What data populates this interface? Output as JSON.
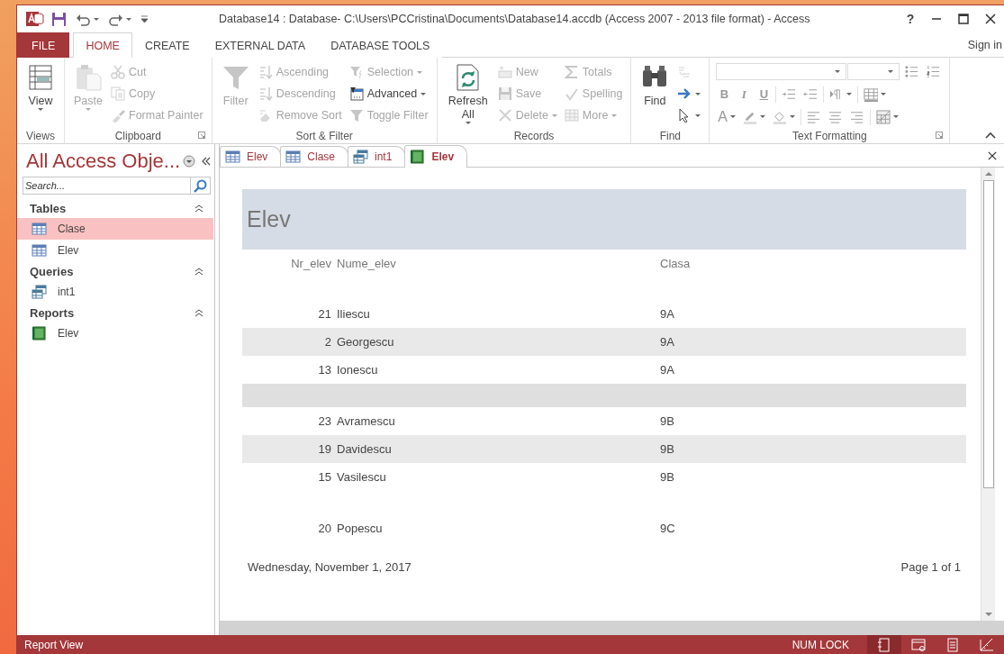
{
  "window": {
    "title": "Database14 : Database- C:\\Users\\PCCristina\\Documents\\Database14.accdb (Access 2007 - 2013 file format) - Access",
    "help": "?"
  },
  "ribbon_tabs": [
    {
      "label": "FILE",
      "kind": "file",
      "selected": false
    },
    {
      "label": "HOME",
      "kind": "tab",
      "selected": true
    },
    {
      "label": "CREATE",
      "kind": "tab",
      "selected": false
    },
    {
      "label": "EXTERNAL DATA",
      "kind": "tab",
      "selected": false
    },
    {
      "label": "DATABASE TOOLS",
      "kind": "tab",
      "selected": false
    }
  ],
  "sign_in": "Sign in",
  "ribbon": {
    "groups": [
      {
        "label": "Views",
        "kind": "commands",
        "launcher": false,
        "commands": [
          {
            "label": "View",
            "kind": "large",
            "disabled": false,
            "dropdown": true
          }
        ]
      },
      {
        "label": "Clipboard",
        "kind": "commands",
        "launcher": true,
        "commands": [
          {
            "label": "Paste",
            "kind": "large",
            "disabled": true,
            "dropdown": true
          },
          {
            "label": "Cut",
            "kind": "small",
            "disabled": true,
            "dropdown": false
          },
          {
            "label": "Copy",
            "kind": "small",
            "disabled": true,
            "dropdown": false
          },
          {
            "label": "Format Painter",
            "kind": "small",
            "disabled": true,
            "dropdown": false
          }
        ]
      },
      {
        "label": "Sort & Filter",
        "kind": "commands",
        "launcher": false,
        "commands": [
          {
            "label": "Filter",
            "kind": "large",
            "disabled": true,
            "dropdown": false
          },
          {
            "label": "Ascending",
            "kind": "small",
            "disabled": true,
            "dropdown": false
          },
          {
            "label": "Descending",
            "kind": "small",
            "disabled": true,
            "dropdown": false
          },
          {
            "label": "Remove Sort",
            "kind": "small",
            "disabled": true,
            "dropdown": false
          },
          {
            "label": "Selection",
            "kind": "small",
            "disabled": true,
            "dropdown": true
          },
          {
            "label": "Advanced",
            "kind": "small",
            "disabled": false,
            "dropdown": true
          },
          {
            "label": "Toggle Filter",
            "kind": "small",
            "disabled": true,
            "dropdown": false
          }
        ]
      },
      {
        "label": "Records",
        "kind": "commands",
        "launcher": false,
        "commands": [
          {
            "label": "Refresh All",
            "kind": "large",
            "disabled": false,
            "dropdown": true
          },
          {
            "label": "New",
            "kind": "small",
            "disabled": true,
            "dropdown": false
          },
          {
            "label": "Save",
            "kind": "small",
            "disabled": true,
            "dropdown": false
          },
          {
            "label": "Delete",
            "kind": "small",
            "disabled": true,
            "dropdown": true
          },
          {
            "label": "Totals",
            "kind": "small",
            "disabled": true,
            "dropdown": false
          },
          {
            "label": "Spelling",
            "kind": "small",
            "disabled": true,
            "dropdown": false
          },
          {
            "label": "More",
            "kind": "small",
            "disabled": true,
            "dropdown": true
          }
        ]
      },
      {
        "label": "Find",
        "kind": "commands",
        "launcher": false,
        "commands": [
          {
            "label": "Find",
            "kind": "large",
            "disabled": false,
            "dropdown": false
          },
          {
            "kind": "small",
            "disabled": true,
            "dropdown": false
          },
          {
            "kind": "small",
            "disabled": false,
            "dropdown": true
          },
          {
            "kind": "small",
            "disabled": false,
            "dropdown": true
          }
        ]
      },
      {
        "label": "Text Formatting",
        "kind": "formatting",
        "launcher": true,
        "glyphs": [
          "B",
          "I",
          "U",
          "A"
        ]
      }
    ]
  },
  "navigation": {
    "title": "All Access Obje...",
    "search_placeholder": "Search...",
    "groups": [
      {
        "label": "Tables",
        "items": [
          {
            "label": "Clase",
            "kind": "table",
            "selected": true
          },
          {
            "label": "Elev",
            "kind": "table",
            "selected": false
          }
        ]
      },
      {
        "label": "Queries",
        "items": [
          {
            "label": "int1",
            "kind": "query",
            "selected": false
          }
        ]
      },
      {
        "label": "Reports",
        "items": [
          {
            "label": "Elev",
            "kind": "report",
            "selected": false
          }
        ]
      }
    ]
  },
  "document_tabs": [
    {
      "label": "Elev",
      "kind": "table",
      "selected": false
    },
    {
      "label": "Clase",
      "kind": "table",
      "selected": false
    },
    {
      "label": "int1",
      "kind": "query",
      "selected": false
    },
    {
      "label": "Elev",
      "kind": "report",
      "selected": true
    }
  ],
  "report": {
    "title": "Elev",
    "columns": [
      "Nr_elev",
      "Nume_elev",
      "Clasa"
    ],
    "rows": [
      {
        "kind": "group",
        "shaded": false
      },
      {
        "kind": "record",
        "shaded": false,
        "cells": [
          "21",
          "Iliescu",
          "9A"
        ]
      },
      {
        "kind": "record",
        "shaded": true,
        "cells": [
          "2",
          "Georgescu",
          "9A"
        ]
      },
      {
        "kind": "record",
        "shaded": false,
        "cells": [
          "13",
          "Ionescu",
          "9A"
        ]
      },
      {
        "kind": "group",
        "shaded": true
      },
      {
        "kind": "record",
        "shaded": false,
        "cells": [
          "23",
          "Avramescu",
          "9B"
        ]
      },
      {
        "kind": "record",
        "shaded": true,
        "cells": [
          "19",
          "Davidescu",
          "9B"
        ]
      },
      {
        "kind": "record",
        "shaded": false,
        "cells": [
          "15",
          "Vasilescu",
          "9B"
        ]
      },
      {
        "kind": "group",
        "shaded": false
      },
      {
        "kind": "record",
        "shaded": false,
        "cells": [
          "20",
          "Popescu",
          "9C"
        ]
      }
    ],
    "date": "Wednesday, November 1, 2017",
    "page": "Page 1 of 1"
  },
  "status_bar": {
    "text": "Report View",
    "num_lock": "NUM LOCK",
    "views": [
      {
        "selected": true
      },
      {
        "selected": false
      },
      {
        "selected": false
      },
      {
        "selected": false
      }
    ]
  }
}
